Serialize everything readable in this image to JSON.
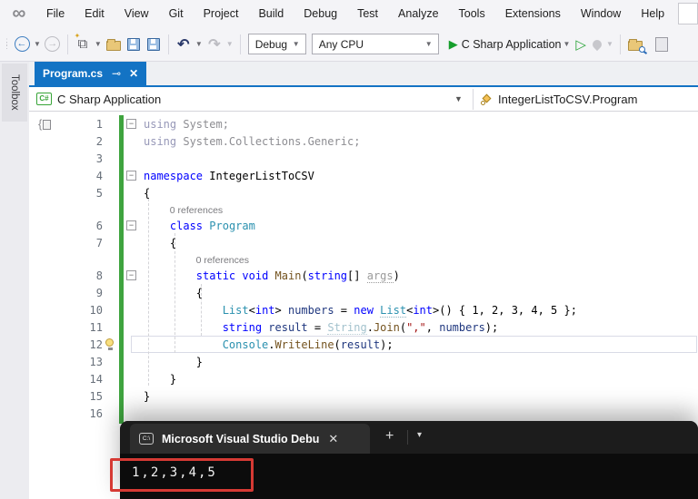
{
  "menu": {
    "items": [
      "File",
      "Edit",
      "View",
      "Git",
      "Project",
      "Build",
      "Debug",
      "Test",
      "Analyze",
      "Tools",
      "Extensions",
      "Window",
      "Help"
    ]
  },
  "toolbar": {
    "debug_config": "Debug",
    "platform": "Any CPU",
    "run_target": "C Sharp Application"
  },
  "toolbox_label": "Toolbox",
  "document_tab": {
    "title": "Program.cs"
  },
  "breadcrumb": {
    "project": "C Sharp Application",
    "type_member": "IntegerListToCSV.Program"
  },
  "editor": {
    "codelens_label": "0 references",
    "rows": [
      {
        "n": "1",
        "fold": true,
        "seg": [
          [
            "kwgray",
            "using"
          ],
          [
            "gray",
            " System;"
          ]
        ]
      },
      {
        "n": "2",
        "seg": [
          [
            "kwgray",
            "using"
          ],
          [
            "gray",
            " System.Collections.Generic;"
          ]
        ]
      },
      {
        "n": "3",
        "seg": []
      },
      {
        "n": "4",
        "fold": true,
        "seg": [
          [
            "kw",
            "namespace"
          ],
          [
            "plain",
            " IntegerListToCSV"
          ]
        ]
      },
      {
        "n": "5",
        "seg": [
          [
            "plain",
            "{"
          ]
        ]
      },
      {
        "ref": true,
        "indent": 1
      },
      {
        "n": "6",
        "fold": true,
        "seg": [
          [
            "plain",
            "    "
          ],
          [
            "kw",
            "class"
          ],
          [
            "plain",
            " "
          ],
          [
            "type",
            "Program"
          ]
        ]
      },
      {
        "n": "7",
        "seg": [
          [
            "plain",
            "    {"
          ]
        ]
      },
      {
        "ref": true,
        "indent": 2
      },
      {
        "n": "8",
        "fold": true,
        "seg": [
          [
            "plain",
            "        "
          ],
          [
            "kw",
            "static"
          ],
          [
            "plain",
            " "
          ],
          [
            "kw",
            "void"
          ],
          [
            "plain",
            " "
          ],
          [
            "meth",
            "Main"
          ],
          [
            "plain",
            "("
          ],
          [
            "kw",
            "string"
          ],
          [
            "plain",
            "[] "
          ],
          [
            "param",
            "args"
          ],
          [
            "plain",
            ")"
          ]
        ]
      },
      {
        "n": "9",
        "seg": [
          [
            "plain",
            "        {"
          ]
        ]
      },
      {
        "n": "10",
        "seg": [
          [
            "plain",
            "            "
          ],
          [
            "type",
            "List"
          ],
          [
            "plain",
            "<"
          ],
          [
            "kw",
            "int"
          ],
          [
            "plain",
            "> "
          ],
          [
            "var",
            "numbers"
          ],
          [
            "plain",
            " = "
          ],
          [
            "kw",
            "new"
          ],
          [
            "plain",
            " "
          ],
          [
            "typeu",
            "List"
          ],
          [
            "plain",
            "<"
          ],
          [
            "kw",
            "int"
          ],
          [
            "plain",
            ">() { 1, 2, 3, 4, 5 };"
          ]
        ]
      },
      {
        "n": "11",
        "seg": [
          [
            "plain",
            "            "
          ],
          [
            "kw",
            "string"
          ],
          [
            "plain",
            " "
          ],
          [
            "var",
            "result"
          ],
          [
            "plain",
            " = "
          ],
          [
            "fade",
            "String"
          ],
          [
            "plain",
            "."
          ],
          [
            "meth",
            "Join"
          ],
          [
            "plain",
            "("
          ],
          [
            "str",
            "\",\""
          ],
          [
            "plain",
            ", "
          ],
          [
            "var",
            "numbers"
          ],
          [
            "plain",
            ");"
          ]
        ]
      },
      {
        "n": "12",
        "bulb": true,
        "seg": [
          [
            "plain",
            "            "
          ],
          [
            "type",
            "Console"
          ],
          [
            "plain",
            "."
          ],
          [
            "meth",
            "WriteLine"
          ],
          [
            "plain",
            "("
          ],
          [
            "var",
            "result"
          ],
          [
            "plain",
            ");"
          ]
        ]
      },
      {
        "n": "13",
        "seg": [
          [
            "plain",
            "        }"
          ]
        ]
      },
      {
        "n": "14",
        "seg": [
          [
            "plain",
            "    }"
          ]
        ]
      },
      {
        "n": "15",
        "seg": [
          [
            "plain",
            "}"
          ]
        ]
      },
      {
        "n": "16",
        "seg": []
      }
    ]
  },
  "terminal": {
    "tab_title": "Microsoft Visual Studio Debu",
    "output": "1,2,3,4,5"
  },
  "colors": {
    "tab_active_blue": "#1373c4",
    "change_bar_green": "#3fa43f",
    "annotation_red": "#d63a34",
    "keyword_blue": "#0000ff",
    "type_teal": "#2b91af",
    "string_red": "#a31515",
    "run_green": "#169e2c"
  }
}
